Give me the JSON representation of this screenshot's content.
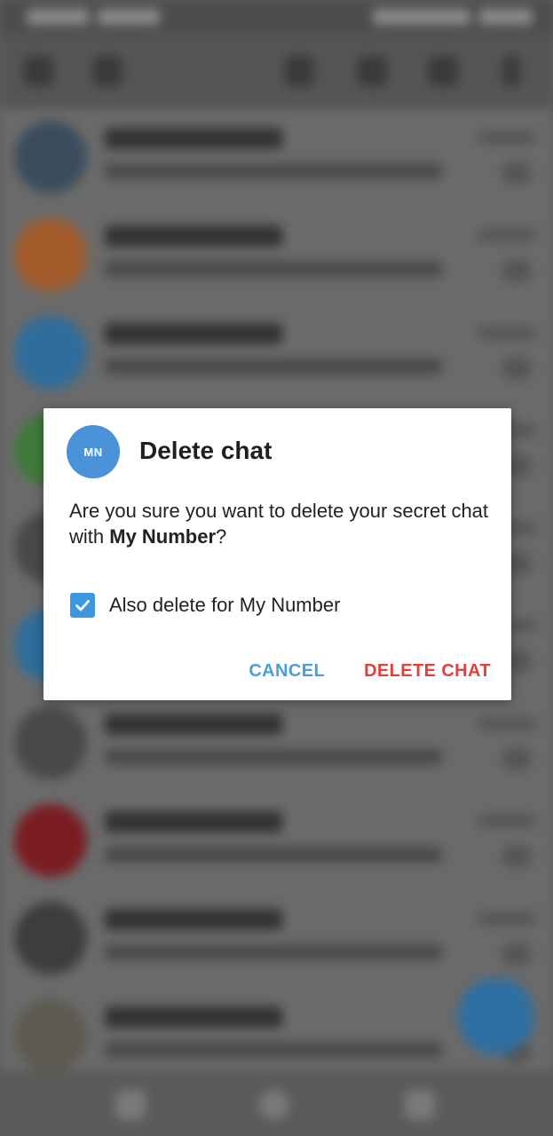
{
  "colors": {
    "accent": "#4a9fd8",
    "danger": "#e0413d",
    "avatar_bg": "#4a93d8",
    "dialog_bg": "#ffffff",
    "checkbox": "#3c98de"
  },
  "background": {
    "chat_avatar_colors": [
      "#3b4d5c",
      "#a35b2b",
      "#2f6d9c",
      "#3f7a3a",
      "#4a4848",
      "#2f6d9c",
      "#4a4848",
      "#7a1d22",
      "#3d3d3d",
      "#5d5a50"
    ]
  },
  "dialog": {
    "avatar_initials": "MN",
    "title": "Delete chat",
    "message_prefix": "Are you sure you want to delete your secret chat with ",
    "message_name": "My Number",
    "message_suffix": "?",
    "checkbox_label": "Also delete for My Number",
    "checkbox_checked": true,
    "cancel_label": "CANCEL",
    "delete_label": "DELETE CHAT"
  }
}
